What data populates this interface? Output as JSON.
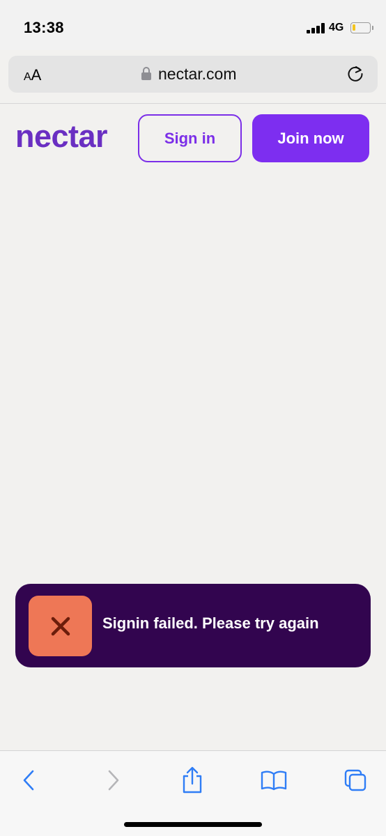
{
  "status_bar": {
    "time": "13:38",
    "network": "4G",
    "battery_level": 0.2,
    "icons": [
      "signal-icon",
      "battery-icon"
    ]
  },
  "browser": {
    "text_size_label_small": "A",
    "text_size_label_large": "A",
    "url": "nectar.com",
    "icons": [
      "lock-icon",
      "reload-icon"
    ],
    "toolbar_icons": [
      "back-icon",
      "forward-icon",
      "share-icon",
      "bookmarks-icon",
      "tabs-icon"
    ]
  },
  "site": {
    "logo": "nectar",
    "signin_label": "Sign in",
    "join_label": "Join now",
    "colors": {
      "brand": "#6a2fc2",
      "accent": "#7d2ef0"
    }
  },
  "toast": {
    "message": "Signin failed. Please try again",
    "icon": "close-icon",
    "colors": {
      "background": "#32054f",
      "icon_bg": "#ee7756",
      "icon_fg": "#6b1d0b"
    }
  }
}
